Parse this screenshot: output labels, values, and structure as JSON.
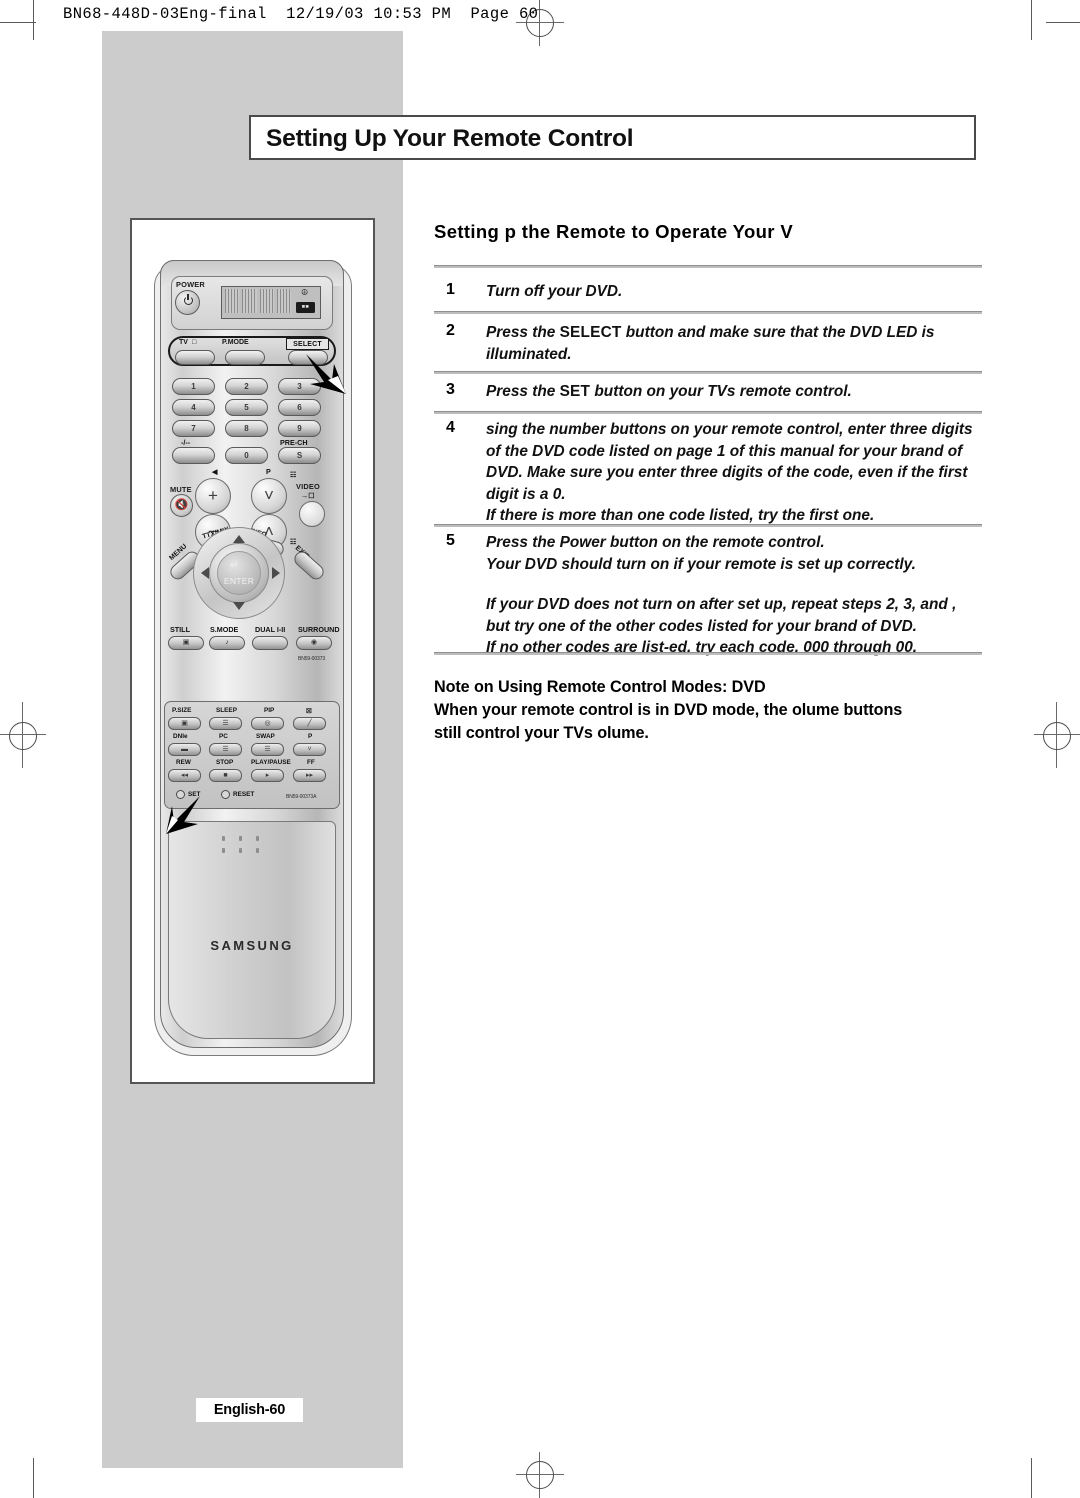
{
  "pdf_header": "BN68-448D-03Eng-final  12/19/03 10:53 PM  Page 60",
  "page": {
    "title": "Setting Up Your Remote Control",
    "badge": "English-60"
  },
  "content": {
    "subhead": "Setting p the Remote to Operate Your V",
    "steps": [
      {
        "num": "1",
        "lines": [
          {
            "text": "Turn off your DVD."
          }
        ]
      },
      {
        "num": "2",
        "lines": [
          {
            "pre": "Press the  ",
            "caps": "SELECT",
            "post": " button and make sure that the DVD LED is illuminated."
          }
        ]
      },
      {
        "num": "3",
        "lines": [
          {
            "pre": "Press the  ",
            "caps": "SET",
            "post": " button on your TVs remote control."
          }
        ]
      },
      {
        "num": "4",
        "lines": [
          {
            "text": "sing the number buttons on your remote control, enter three  digits of the DVD code listed on page 1 of this manual for your brand of DVD. Make sure you enter three digits of the code, even if the first digit is a 0."
          },
          {
            "text": "If there is more than one code listed, try the first one."
          }
        ]
      },
      {
        "num": "5",
        "lines": [
          {
            "text": "Press the Power button on the remote control."
          },
          {
            "text": "Your DVD should turn on if your remote is set up correctly."
          },
          {
            "text": "If your DVD does not turn on after set up, repeat steps 2, 3, and , but try one of the other codes listed for your brand of DVD.",
            "gap": true
          },
          {
            "text": "If no other codes are list-ed, try each code, 000 through 00."
          }
        ]
      }
    ],
    "note": [
      "Note on Using Remote Control Modes: DVD",
      "When your remote control is in DVD mode, the olume buttons",
      "still control your TVs olume."
    ]
  },
  "remote": {
    "power_label": "POWER",
    "display": {
      "wifi_icon": "antenna-icon",
      "battery_icon": "battery-icon"
    },
    "mode_row": {
      "tv": "TV",
      "pmode": "P.MODE",
      "select": "SELECT"
    },
    "keypad": [
      "1",
      "2",
      "3",
      "4",
      "5",
      "6",
      "7",
      "8",
      "9",
      "0"
    ],
    "keypad_extra": {
      "dash": "-/--",
      "prech": "PRE-CH",
      "s_button": "S"
    },
    "mute_label": "MUTE",
    "video_label": "VIDEO",
    "p_label": "P",
    "ttx_label": "TTX/MIX",
    "info_label": "INFO",
    "menu_label": "MENU",
    "exit_label": "EXIT",
    "enter_label": "ENTER",
    "function_row": [
      "STILL",
      "S.MODE",
      "DUAL I-II",
      "SURROUND"
    ],
    "part_no_top": "BN59-00373",
    "lower_panel_rows": [
      [
        "P.SIZE",
        "SLEEP",
        "PIP",
        "SOURCE"
      ],
      [
        "DNIe",
        "PC",
        "SWAP",
        "P"
      ],
      [
        "REW",
        "STOP",
        "PLAY/PAUSE",
        "FF"
      ]
    ],
    "set_label": "SET",
    "reset_label": "RESET",
    "part_no_bottom": "BN59-00373A",
    "brand": "SAMSUNG"
  }
}
